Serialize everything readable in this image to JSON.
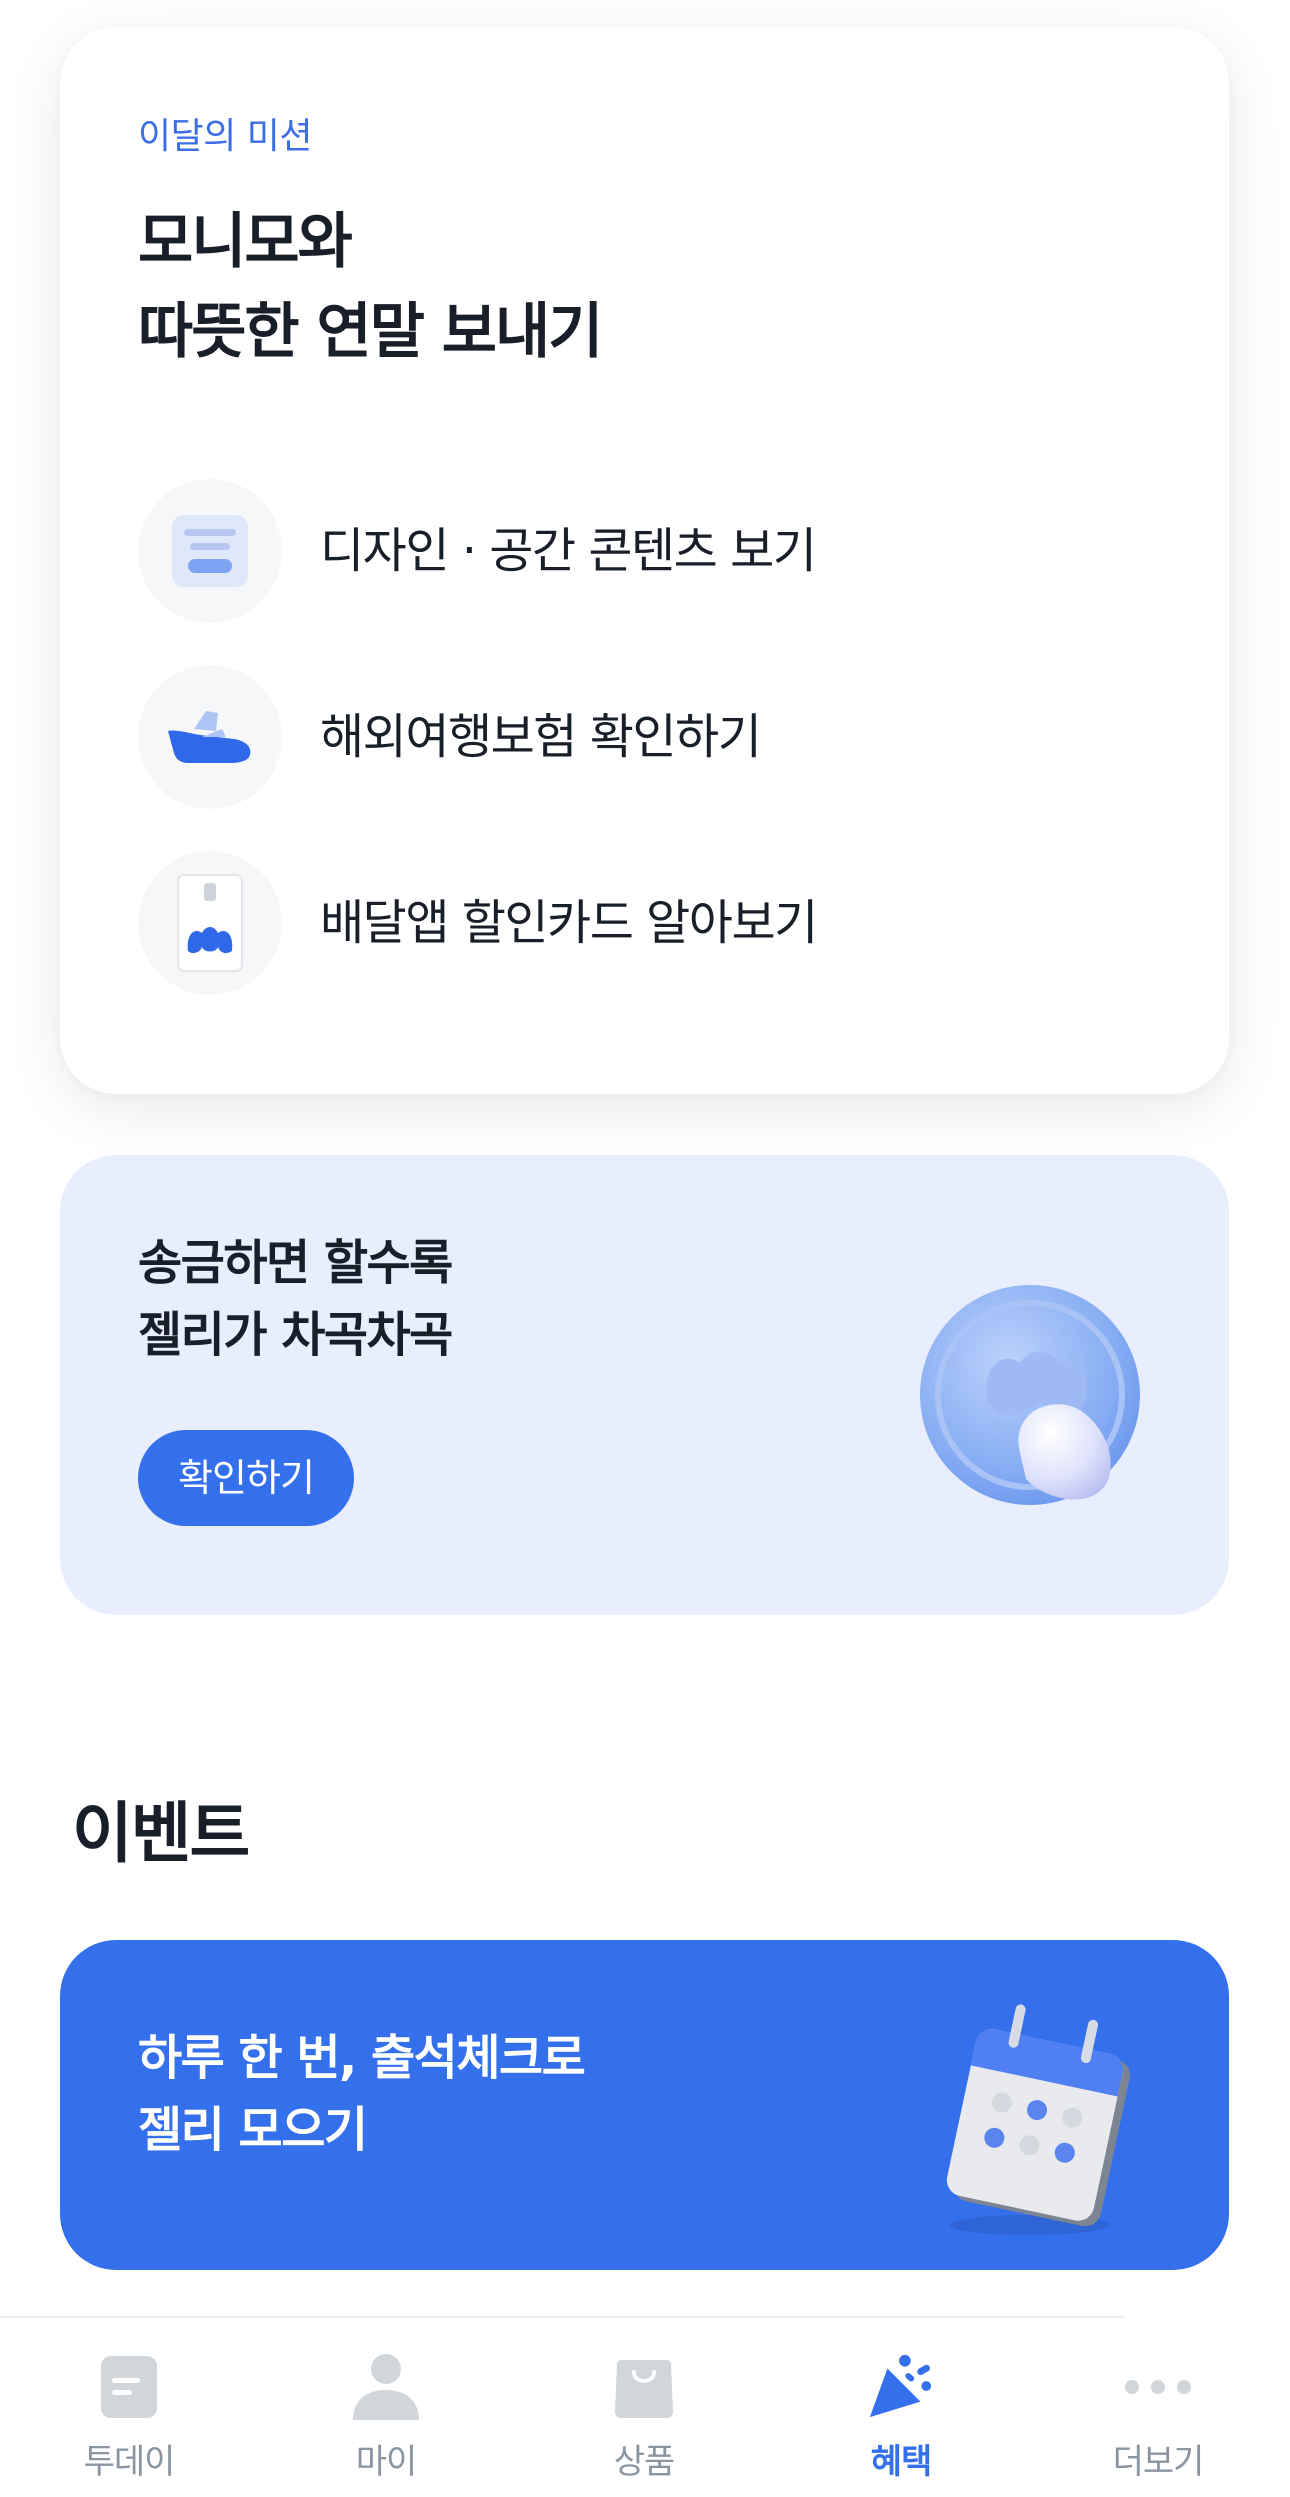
{
  "mission": {
    "eyebrow": "이달의 미션",
    "title_line1": "모니모와",
    "title_line2": "따뜻한 연말 보내기",
    "items": [
      {
        "label": "디자인 · 공간 콘텐츠 보기",
        "icon": "content-card-icon"
      },
      {
        "label": "해외여행보험 확인하기",
        "icon": "airplane-icon"
      },
      {
        "label": "배달앱 할인카드 알아보기",
        "icon": "card-icon"
      }
    ]
  },
  "transfer_banner": {
    "title_line1": "송금하면 할수록",
    "title_line2": "젤리가 차곡차곡",
    "button_label": "확인하기",
    "illustration": "jelly-coin-icon"
  },
  "events": {
    "section_title": "이벤트",
    "banner": {
      "title_line1": "하루 한 번, 출석체크로",
      "title_line2": "젤리 모으기",
      "illustration": "calendar-icon"
    }
  },
  "tab_bar": {
    "active_tab": "혜택",
    "tabs": [
      {
        "label": "투데이",
        "icon": "today-icon"
      },
      {
        "label": "마이",
        "icon": "person-icon"
      },
      {
        "label": "상품",
        "icon": "shopping-bag-icon"
      },
      {
        "label": "혜택",
        "icon": "party-popper-icon"
      },
      {
        "label": "더보기",
        "icon": "more-dots-icon"
      }
    ]
  },
  "colors": {
    "accent": "#3570ec",
    "eyebrow": "#3c6fe6",
    "banner_light": "#e8eefd",
    "text_primary": "#191f28",
    "text_inactive": "#8b95a1",
    "icon_inactive": "#d1d6db"
  }
}
